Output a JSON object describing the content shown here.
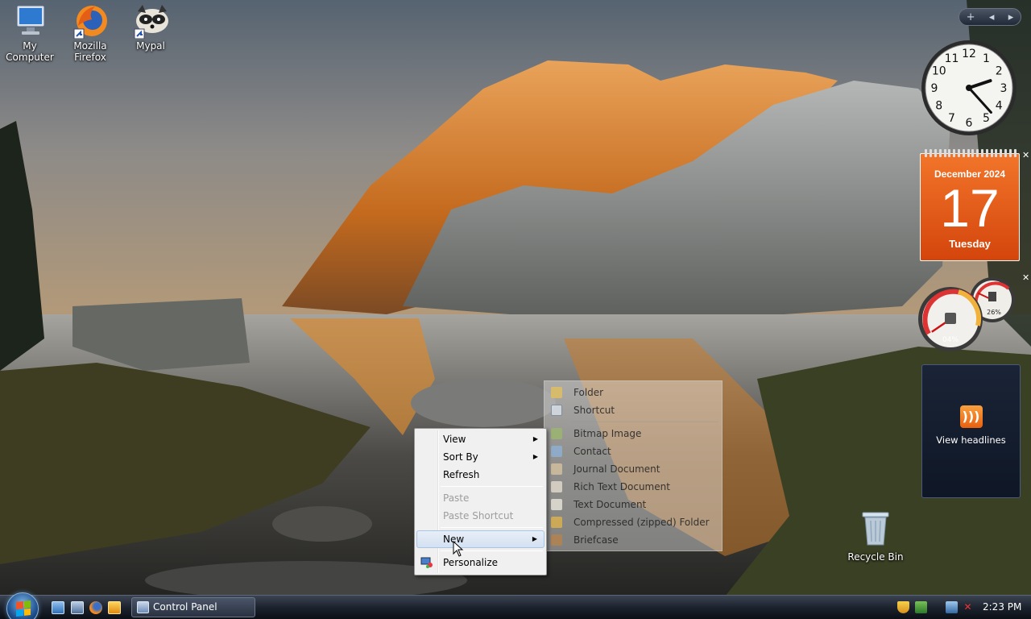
{
  "desktop": {
    "icons": [
      {
        "label_line1": "My",
        "label_line2": "Computer"
      },
      {
        "label_line1": "Mozilla",
        "label_line2": "Firefox"
      },
      {
        "label_line1": "Mypal",
        "label_line2": ""
      }
    ],
    "recycle_bin": "Recycle Bin"
  },
  "gadgets": {
    "toolbar": {
      "add": "+",
      "prev": "◂",
      "next": "▸"
    },
    "clock": {
      "numbers": [
        "12",
        "1",
        "2",
        "3",
        "4",
        "5",
        "6",
        "7",
        "8",
        "9",
        "10",
        "11"
      ],
      "hour": 2,
      "minute": 23
    },
    "calendar": {
      "month_year": "December 2024",
      "day": "17",
      "weekday": "Tuesday"
    },
    "meters": {
      "cpu": "04%",
      "memory": "26%",
      "cpu_value": 0.04,
      "memory_value": 0.26
    },
    "feed": {
      "label": "View headlines"
    }
  },
  "context_menu": {
    "items": [
      {
        "label": "View",
        "submenu": true
      },
      {
        "label": "Sort By",
        "submenu": true
      },
      {
        "label": "Refresh"
      },
      {
        "label": "Paste",
        "disabled": true
      },
      {
        "label": "Paste Shortcut",
        "disabled": true
      },
      {
        "label": "New",
        "submenu": true,
        "highlighted": true
      },
      {
        "label": "Personalize"
      }
    ]
  },
  "new_submenu": {
    "items": [
      {
        "label": "Folder",
        "icon": "folder-icon"
      },
      {
        "label": "Shortcut",
        "icon": "shortcut-icon"
      },
      {
        "label": "Bitmap Image",
        "icon": "bitmap-icon"
      },
      {
        "label": "Contact",
        "icon": "contact-icon"
      },
      {
        "label": "Journal Document",
        "icon": "journal-icon"
      },
      {
        "label": "Rich Text Document",
        "icon": "rich-text-icon"
      },
      {
        "label": "Text Document",
        "icon": "text-document-icon"
      },
      {
        "label": "Compressed (zipped) Folder",
        "icon": "zip-folder-icon"
      },
      {
        "label": "Briefcase",
        "icon": "briefcase-icon"
      }
    ]
  },
  "taskbar": {
    "open_window": "Control Panel",
    "time": "2:23 PM"
  },
  "colors": {
    "calendar": "#e35a1a",
    "taskbar": "#1c232e",
    "menu_highlight": "#d4e1f1"
  }
}
